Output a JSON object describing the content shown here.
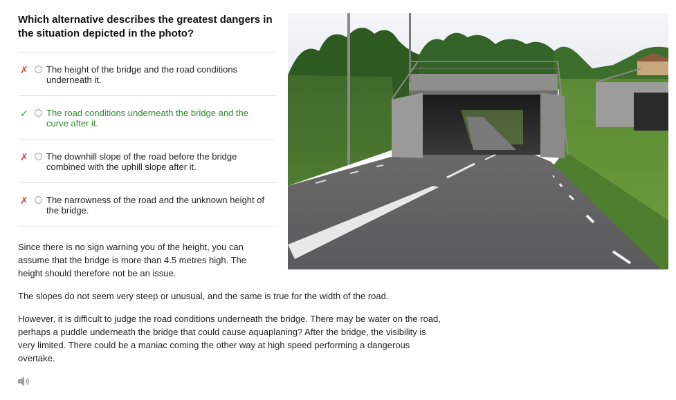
{
  "question": "Which alternative describes the greatest dangers in the situation depicted in the photo?",
  "options": [
    {
      "text": "The height of the bridge and the road conditions underneath it.",
      "status": "wrong",
      "mark": "✗"
    },
    {
      "text": "The road conditions underneath the bridge and the curve after it.",
      "status": "correct",
      "mark": "✓"
    },
    {
      "text": "The downhill slope of the road before the bridge combined with the uphill slope after it.",
      "status": "wrong",
      "mark": "✗"
    },
    {
      "text": "The narrowness of the road and the unknown height of the bridge.",
      "status": "wrong",
      "mark": "✗"
    }
  ],
  "explanation": [
    "Since there is no sign warning you of the height, you can assume that the bridge is more than 4.5 metres high. The height should therefore not be an issue.",
    "The slopes do not seem very steep or unusual, and the same is true for the width of the road.",
    "However, it is difficult to judge the road conditions underneath the bridge. There may be water on the road, perhaps a puddle underneath the bridge that could cause aquaplaning? After the bridge, the visibility is very limited. There could be a maniac coming the other way at high speed performing a dangerous overtake."
  ],
  "photo": {
    "icon": "road-under-bridge-photo"
  },
  "audio": {
    "icon": "speaker-icon"
  },
  "colors": {
    "wrong": "#d84040",
    "correct": "#2f8a2f",
    "text": "#222222",
    "divider": "#e2e2e2"
  }
}
